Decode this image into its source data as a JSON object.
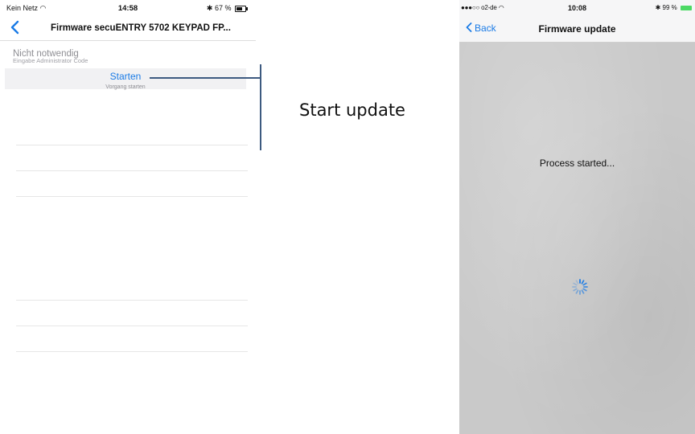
{
  "left_screen": {
    "status": {
      "carrier": "Kein Netz",
      "time": "14:58",
      "battery": "67 %"
    },
    "nav": {
      "title": "Firmware secuENTRY 5702 KEYPAD FP..."
    },
    "rows": {
      "code": {
        "main": "Nicht notwendig",
        "sub": "Eingabe Administrator Code"
      },
      "start": {
        "main": "Starten",
        "sub": "Vorgang starten"
      }
    }
  },
  "callout": {
    "label": "Start update"
  },
  "right_screen": {
    "status": {
      "carrier": "●●●○○ o2-de",
      "time": "10:08",
      "battery": "99 %"
    },
    "nav": {
      "back": "Back",
      "title": "Firmware update"
    },
    "message": "Process started..."
  },
  "colors": {
    "accent": "#1a7be6",
    "callout_line": "#3d5a80",
    "battery_green": "#4cd964"
  }
}
